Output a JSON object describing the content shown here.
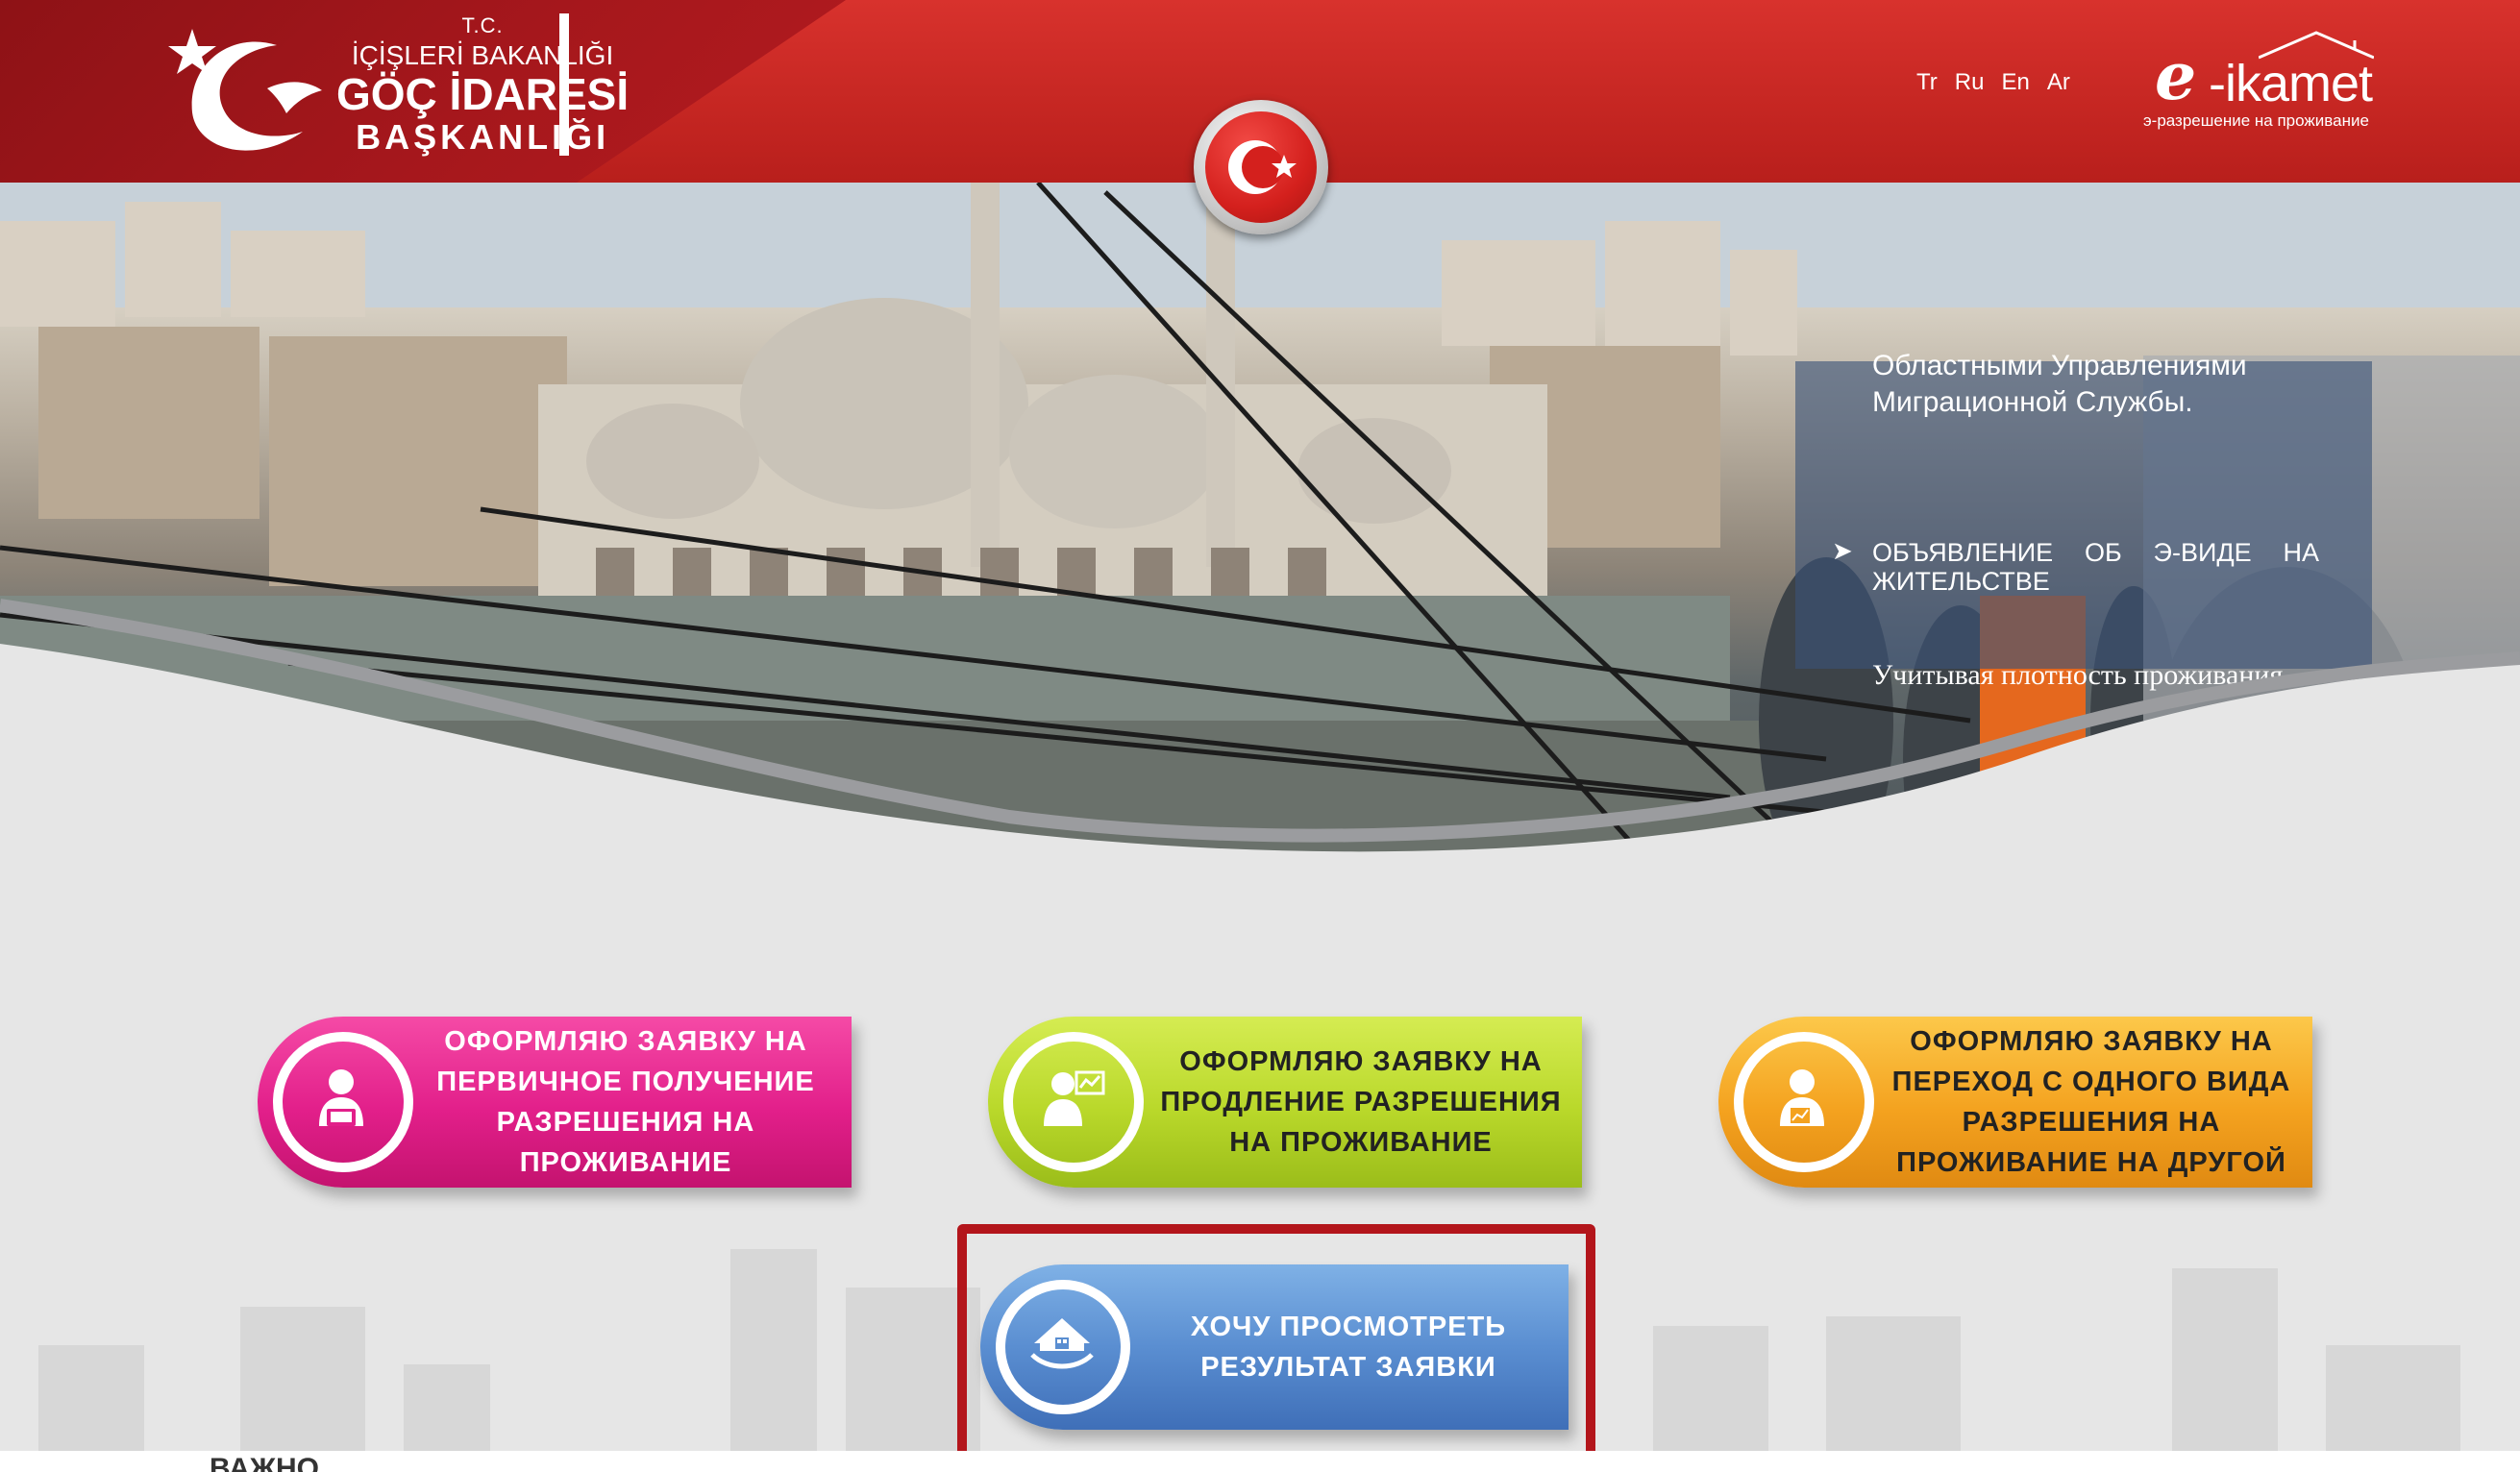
{
  "header": {
    "logo": {
      "tc": "T.C.",
      "ministry": "İÇİŞLERİ BAKANLIĞI",
      "directorate": "GÖÇ İDARESİ",
      "presidency": "BAŞKANLIĞI"
    },
    "languages": [
      "Tr",
      "Ru",
      "En",
      "Ar"
    ],
    "brand": {
      "e": "e",
      "word": "-ikamet",
      "subtitle": "э-разрешение на проживание"
    }
  },
  "news": {
    "line1": "Областными Управлениями",
    "line2": "Миграционной Службы.",
    "headline": "ОБЪЯВЛЕНИЕ ОБ Э-ВИДЕ НА ЖИТЕЛЬСТВЕ",
    "body": "Учитывая плотность проживания"
  },
  "actions": {
    "first": "ОФОРМЛЯЮ ЗАЯВКУ НА ПЕРВИЧНОЕ ПОЛУЧЕНИЕ РАЗРЕШЕНИЯ НА ПРОЖИВАНИЕ",
    "extend": "ОФОРМЛЯЮ ЗАЯВКУ НА ПРОДЛЕНИЕ РАЗРЕШЕНИЯ НА ПРОЖИВАНИЕ",
    "transfer": "ОФОРМЛЯЮ ЗАЯВКУ НА ПЕРЕХОД С ОДНОГО ВИДА РАЗРЕШЕНИЯ НА ПРОЖИВАНИЕ НА ДРУГОЙ",
    "check": "ХОЧУ ПРОСМОТРЕТЬ РЕЗУЛЬТАТ ЗАЯВКИ"
  },
  "footer": {
    "heading": "ВАЖНО"
  },
  "colors": {
    "header_red": "#c52622",
    "pink": "#e21f8a",
    "green": "#b9d82a",
    "orange": "#f4a21f",
    "blue": "#5a8ed1",
    "highlight": "#b3151b"
  }
}
